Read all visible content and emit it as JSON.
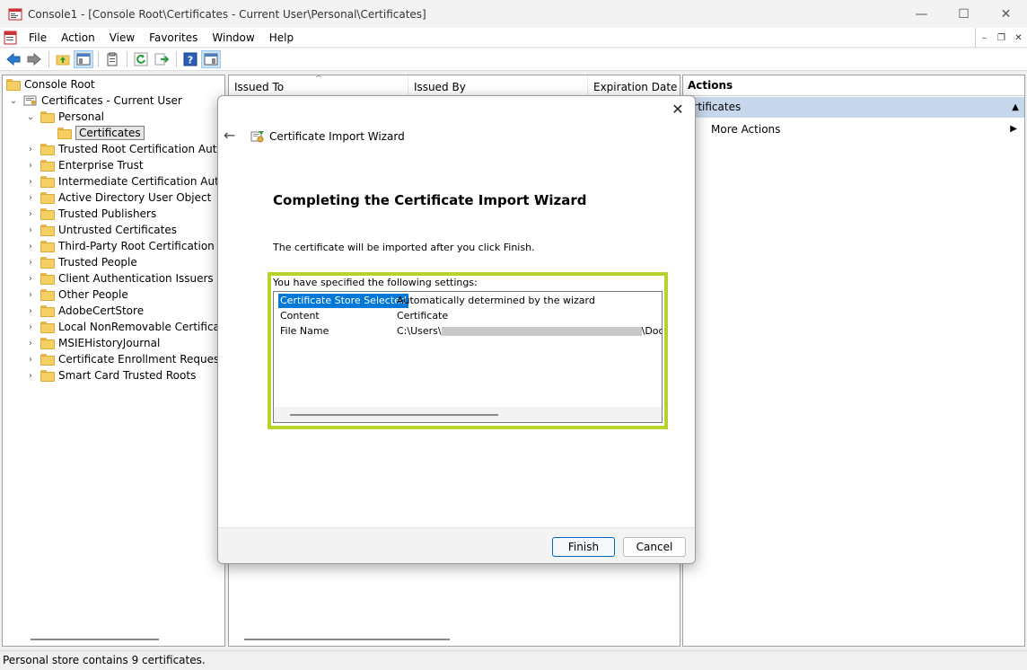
{
  "window": {
    "title": "Console1 - [Console Root\\Certificates - Current User\\Personal\\Certificates]",
    "minimize_glyph": "—",
    "maximize_glyph": "☐",
    "close_glyph": "✕"
  },
  "menubar": {
    "items": [
      "File",
      "Action",
      "View",
      "Favorites",
      "Window",
      "Help"
    ],
    "mdi_minimize": "–",
    "mdi_restore": "❐",
    "mdi_close": "✕"
  },
  "toolbar": {
    "buttons": [
      "back-icon",
      "forward-icon",
      "up-folder-icon",
      "show-hide-tree-icon",
      "properties-icon",
      "refresh-icon",
      "export-list-icon",
      "help-icon",
      "show-hide-action-pane-icon"
    ]
  },
  "tree": {
    "root": "Console Root",
    "certs_current_user": "Certificates - Current User",
    "personal": "Personal",
    "certificates": "Certificates",
    "stores": [
      "Trusted Root Certification Authori",
      "Enterprise Trust",
      "Intermediate Certification Authori",
      "Active Directory User Object",
      "Trusted Publishers",
      "Untrusted Certificates",
      "Third-Party Root Certification Aut",
      "Trusted People",
      "Client Authentication Issuers",
      "Other People",
      "AdobeCertStore",
      "Local NonRemovable Certificates",
      "MSIEHistoryJournal",
      "Certificate Enrollment Requests",
      "Smart Card Trusted Roots"
    ]
  },
  "list": {
    "columns": [
      "Issued To",
      "Issued By",
      "Expiration Date"
    ]
  },
  "actions": {
    "header": "Actions",
    "section": "ertificates",
    "more_actions": "More Actions"
  },
  "status": {
    "text": "Personal store contains 9 certificates."
  },
  "wizard": {
    "title": "Certificate Import Wizard",
    "heading": "Completing the Certificate Import Wizard",
    "intro": "The certificate will be imported after you click Finish.",
    "settings_label": "You have specified the following settings:",
    "settings": [
      {
        "key": "Certificate Store Selected",
        "value": "Automatically determined by the wizard"
      },
      {
        "key": "Content",
        "value": "Certificate"
      },
      {
        "key": "File Name",
        "value_prefix": "C:\\Users\\",
        "value_suffix": "\\Doc"
      }
    ],
    "finish": "Finish",
    "cancel": "Cancel",
    "close_glyph": "✕",
    "back_glyph": "←",
    "highlight_color": "#b5d32a"
  }
}
